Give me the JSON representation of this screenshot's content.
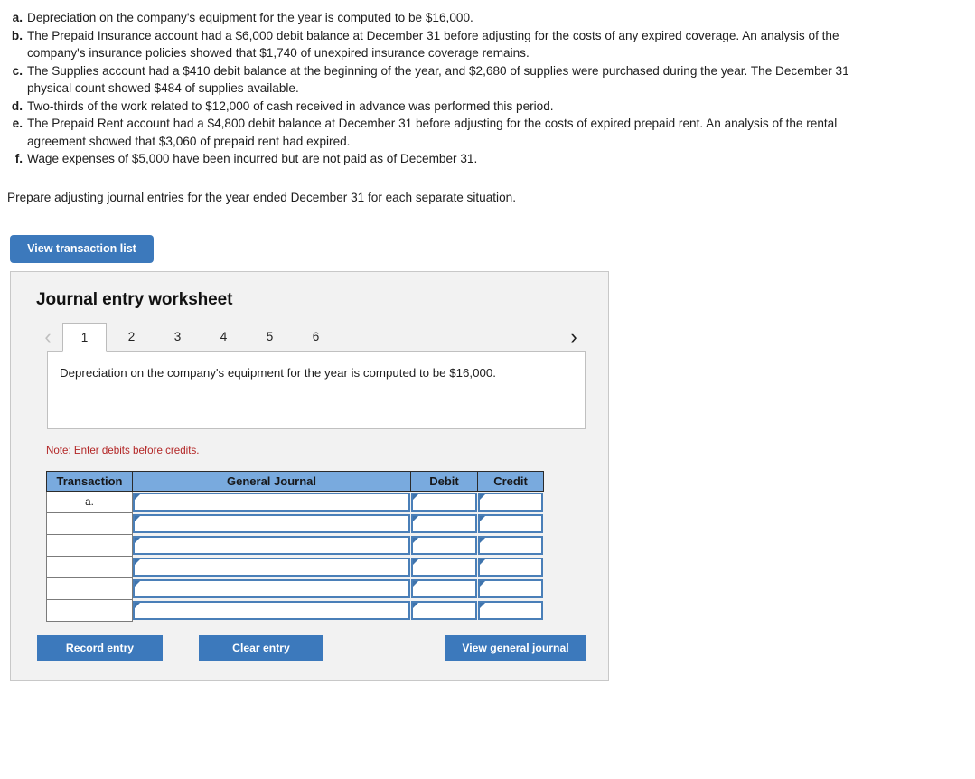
{
  "problems": [
    {
      "letter": "a.",
      "text": "Depreciation on the company's equipment for the year is computed to be $16,000."
    },
    {
      "letter": "b.",
      "text": "The Prepaid Insurance account had a $6,000 debit balance at December 31 before adjusting for the costs of any expired coverage. An analysis of the company's insurance policies showed that $1,740 of unexpired insurance coverage remains."
    },
    {
      "letter": "c.",
      "text": "The Supplies account had a $410 debit balance at the beginning of the year, and $2,680 of supplies were purchased during the year. The December 31 physical count showed $484 of supplies available."
    },
    {
      "letter": "d.",
      "text": "Two-thirds of the work related to $12,000 of cash received in advance was performed this period."
    },
    {
      "letter": "e.",
      "text": "The Prepaid Rent account had a $4,800 debit balance at December 31 before adjusting for the costs of expired prepaid rent. An analysis of the rental agreement showed that $3,060 of prepaid rent had expired."
    },
    {
      "letter": "f.",
      "text": "Wage expenses of $5,000 have been incurred but are not paid as of December 31."
    }
  ],
  "instruction": "Prepare adjusting journal entries for the year ended December 31 for each separate situation.",
  "view_transaction_list_label": "View transaction list",
  "worksheet": {
    "title": "Journal entry worksheet",
    "prev_icon": "chevron-left-icon",
    "prev_glyph": "‹",
    "next_icon": "chevron-right-icon",
    "next_glyph": "›",
    "tabs": [
      "1",
      "2",
      "3",
      "4",
      "5",
      "6"
    ],
    "active_tab_index": 0,
    "content_text": "Depreciation on the company's equipment for the year is computed to be $16,000.",
    "note": "Note: Enter debits before credits.",
    "table": {
      "headers": [
        "Transaction",
        "General Journal",
        "Debit",
        "Credit"
      ],
      "rows": [
        {
          "transaction": "a.",
          "general_journal": "",
          "debit": "",
          "credit": ""
        },
        {
          "transaction": "",
          "general_journal": "",
          "debit": "",
          "credit": ""
        },
        {
          "transaction": "",
          "general_journal": "",
          "debit": "",
          "credit": ""
        },
        {
          "transaction": "",
          "general_journal": "",
          "debit": "",
          "credit": ""
        },
        {
          "transaction": "",
          "general_journal": "",
          "debit": "",
          "credit": ""
        },
        {
          "transaction": "",
          "general_journal": "",
          "debit": "",
          "credit": ""
        }
      ]
    },
    "buttons": {
      "record": "Record entry",
      "clear": "Clear entry",
      "view_general_journal": "View general journal"
    }
  },
  "colors": {
    "button_blue": "#3c79bc",
    "header_blue": "#79aade",
    "note_red": "#b32626",
    "panel_gray": "#f2f2f2",
    "input_border_blue": "#4a7fb8"
  }
}
